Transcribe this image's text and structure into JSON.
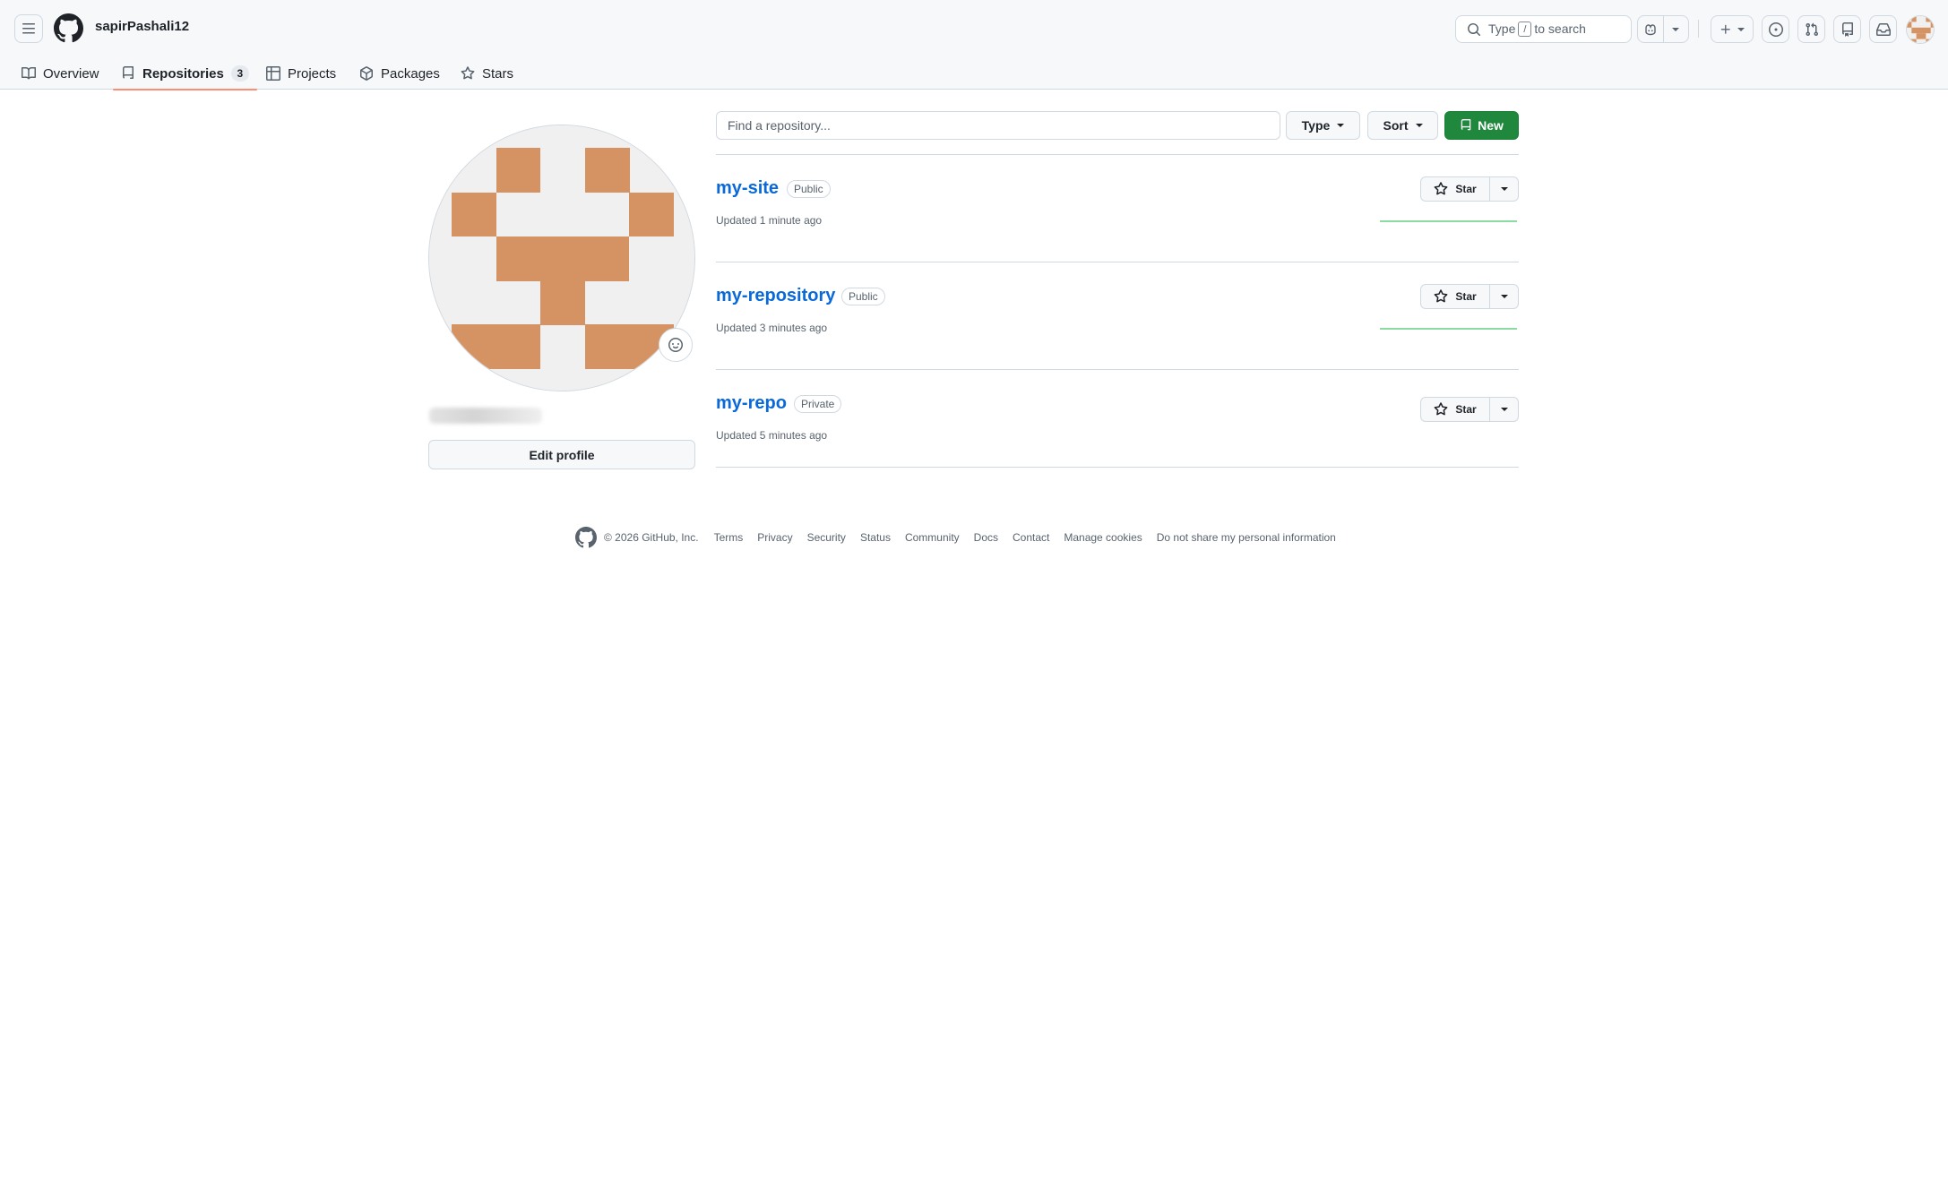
{
  "header": {
    "username": "sapirPashali12",
    "search": {
      "prefix": "Type",
      "key": "/",
      "suffix": "to search"
    }
  },
  "tabs": [
    {
      "label": "Overview",
      "icon": "book-icon"
    },
    {
      "label": "Repositories",
      "icon": "repo-icon",
      "count": "3",
      "selected": true
    },
    {
      "label": "Projects",
      "icon": "table-icon"
    },
    {
      "label": "Packages",
      "icon": "package-icon"
    },
    {
      "label": "Stars",
      "icon": "star-icon"
    }
  ],
  "sidebar": {
    "edit_profile_label": "Edit profile"
  },
  "toolbar": {
    "find_placeholder": "Find a repository...",
    "type_label": "Type",
    "sort_label": "Sort",
    "new_label": "New"
  },
  "repos": [
    {
      "name": "my-site",
      "visibility": "Public",
      "updated": "Updated 1 minute ago",
      "star_label": "Star"
    },
    {
      "name": "my-repository",
      "visibility": "Public",
      "updated": "Updated 3 minutes ago",
      "star_label": "Star"
    },
    {
      "name": "my-repo",
      "visibility": "Private",
      "updated": "Updated 5 minutes ago",
      "star_label": "Star"
    }
  ],
  "footer": {
    "copyright": "© 2026 GitHub, Inc.",
    "links": [
      "Terms",
      "Privacy",
      "Security",
      "Status",
      "Community",
      "Docs",
      "Contact",
      "Manage cookies",
      "Do not share my personal information"
    ]
  },
  "colors": {
    "accent_link": "#0969da",
    "primary_button": "#1f883d",
    "tab_underline": "#fd8c73",
    "identicon": "#d59262"
  }
}
